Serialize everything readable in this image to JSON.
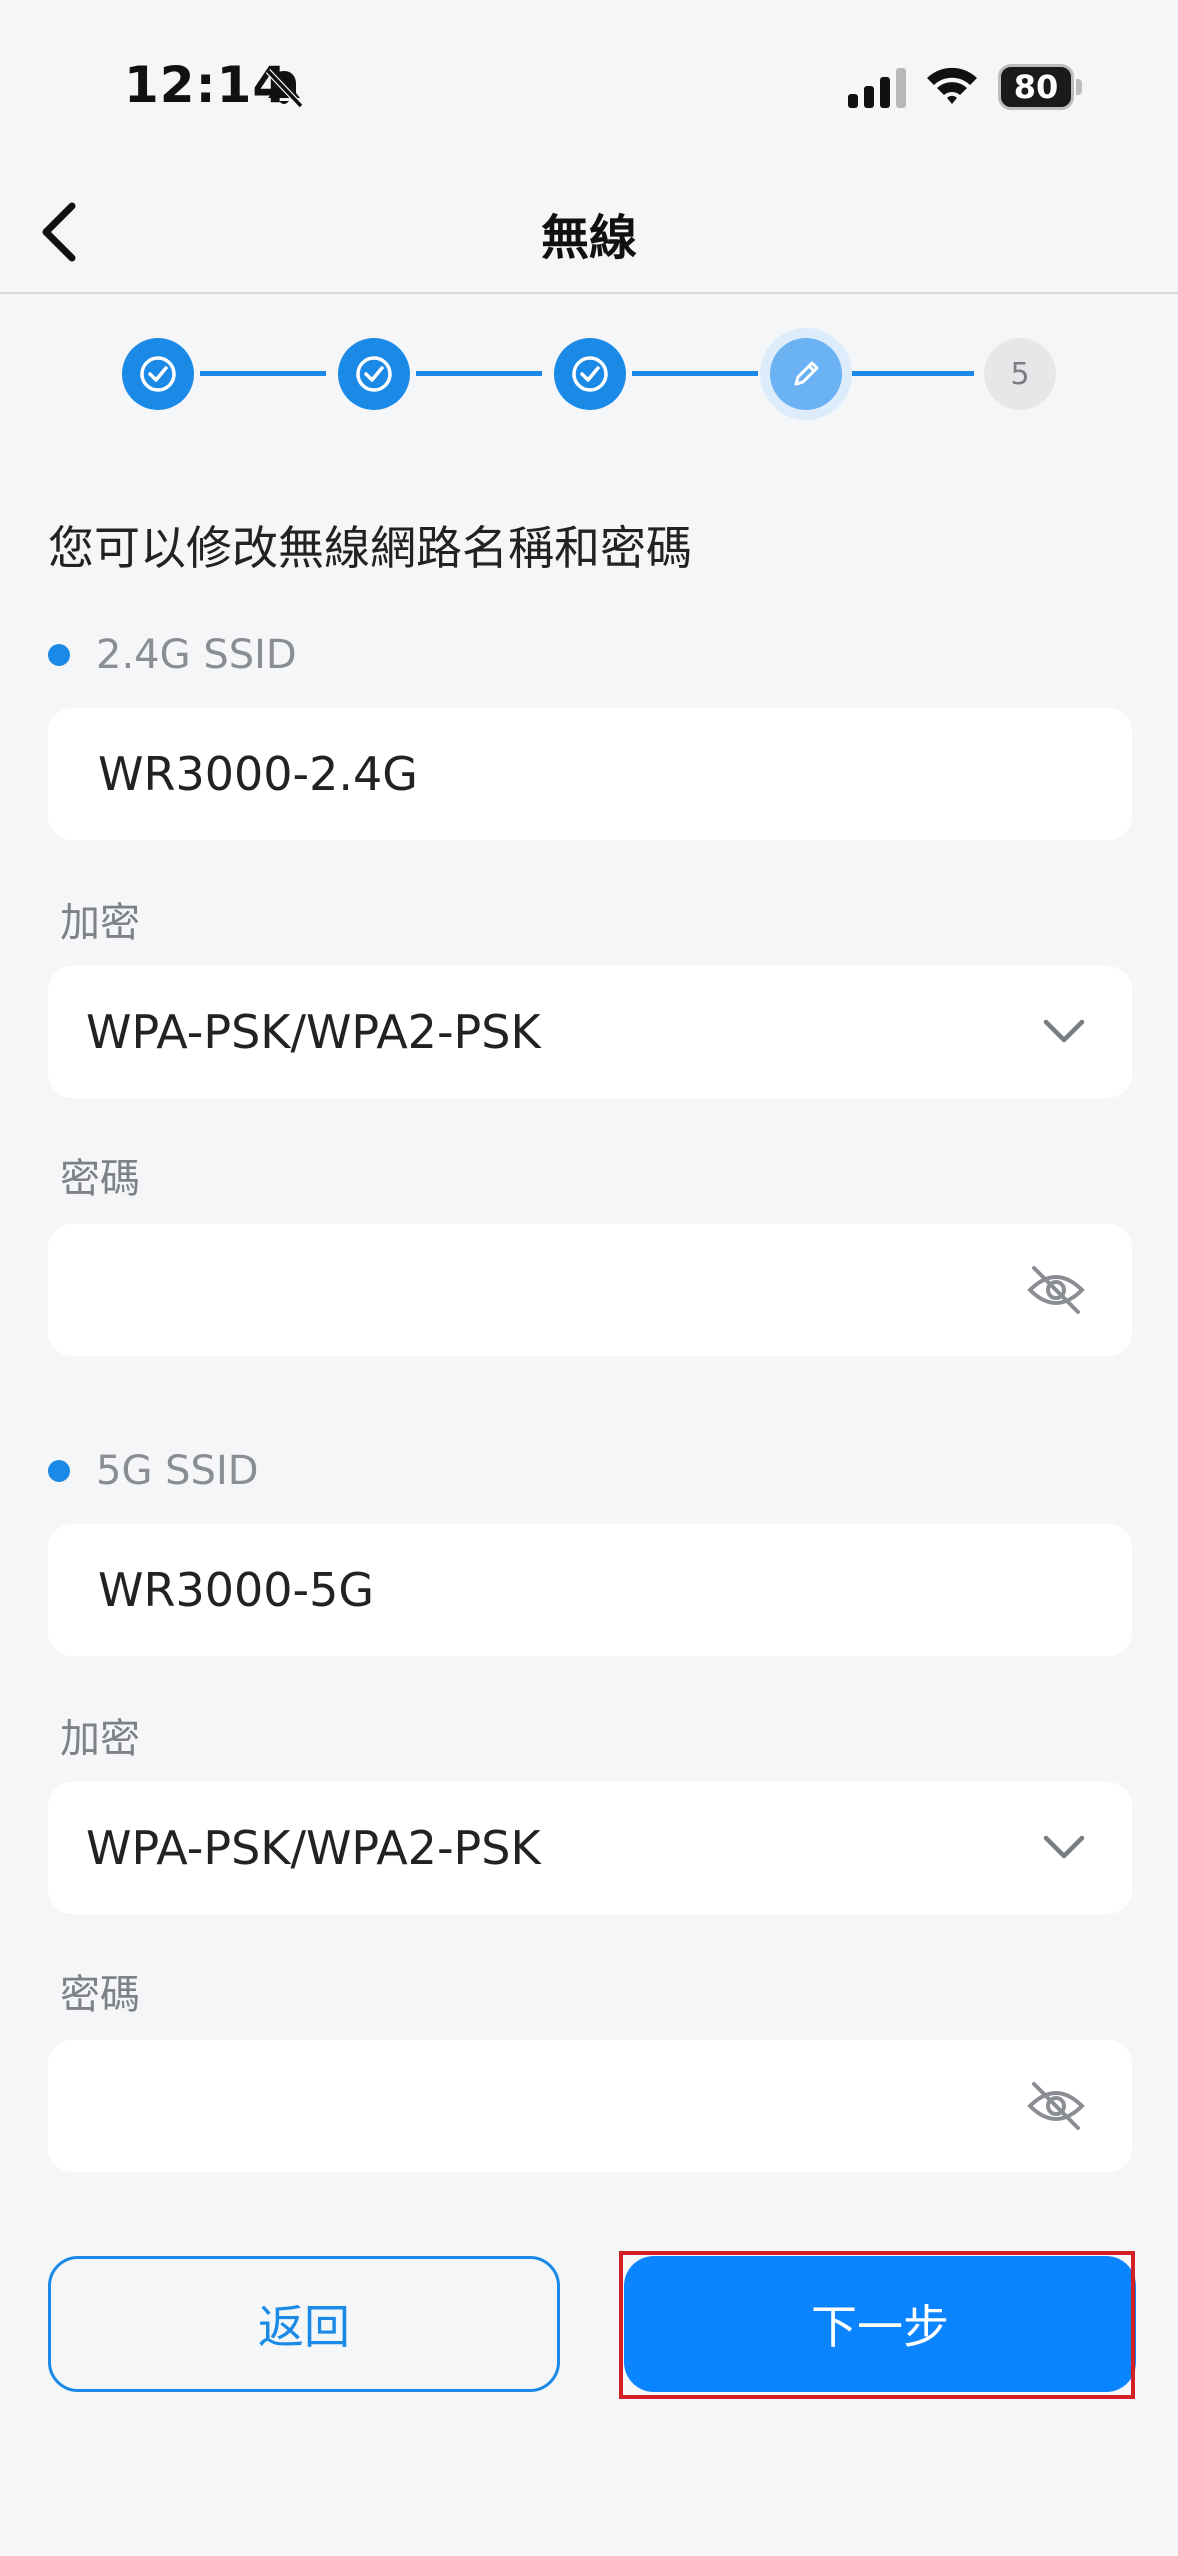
{
  "status_bar": {
    "time": "12:14",
    "battery": "80",
    "icons": [
      "bell-slash-icon",
      "cellular-signal-icon",
      "wifi-icon",
      "battery-icon"
    ]
  },
  "nav": {
    "title": "無線",
    "back_icon": "chevron-left-icon"
  },
  "stepper": {
    "steps": [
      {
        "state": "done",
        "icon": "check-icon"
      },
      {
        "state": "done",
        "icon": "check-icon"
      },
      {
        "state": "done",
        "icon": "check-icon"
      },
      {
        "state": "current",
        "icon": "pencil-icon"
      },
      {
        "state": "todo",
        "label": "5"
      }
    ],
    "current_step": 4,
    "total_steps": 5
  },
  "intro": "您可以修改無線網路名稱和密碼",
  "band_24": {
    "label": "2.4G SSID",
    "ssid": "WR3000-2.4G",
    "encryption_label": "加密",
    "encryption": "WPA-PSK/WPA2-PSK",
    "password_label": "密碼",
    "password": ""
  },
  "band_5": {
    "label": "5G SSID",
    "ssid": "WR3000-5G",
    "encryption_label": "加密",
    "encryption": "WPA-PSK/WPA2-PSK",
    "password_label": "密碼",
    "password": ""
  },
  "buttons": {
    "back": "返回",
    "next": "下一步"
  },
  "colors": {
    "accent": "#1a8ae6",
    "primary_button": "#0b84ff",
    "highlight": "#d31f26"
  }
}
